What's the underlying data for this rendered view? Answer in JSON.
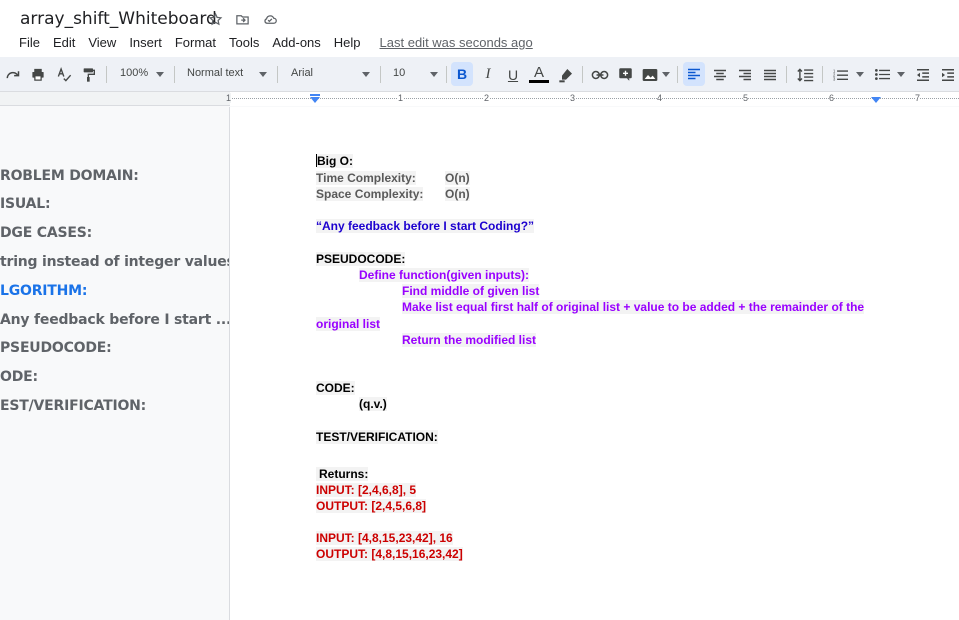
{
  "doc_title": "array_shift_Whiteboard",
  "menu": [
    "File",
    "Edit",
    "View",
    "Insert",
    "Format",
    "Tools",
    "Add-ons",
    "Help"
  ],
  "last_edit": "Last edit was seconds ago",
  "toolbar": {
    "zoom": "100%",
    "style": "Normal text",
    "font": "Arial",
    "size": "10",
    "bold": "B",
    "italic": "I",
    "underline": "U",
    "text_color": "A"
  },
  "ruler_numbers": [
    "1",
    "1",
    "2",
    "3",
    "4",
    "5",
    "6",
    "7"
  ],
  "outline": [
    "ROBLEM DOMAIN:",
    "ISUAL:",
    "DGE CASES:",
    "tring instead of integer values",
    "LGORITHM:",
    "Any feedback before I start ...",
    "PSEUDOCODE:",
    "ODE:",
    "EST/VERIFICATION:"
  ],
  "doc": {
    "big_o": "Big O:",
    "time_label": "Time Complexity:",
    "time_value": "O(n)",
    "space_label": "Space Complexity:",
    "space_value": "O(n)",
    "feedback": "“Any feedback before I start Coding?”",
    "pseudocode_heading": "PSEUDOCODE:",
    "pseudo_1": "Define function(given inputs):",
    "pseudo_2": "Find middle of given list",
    "pseudo_3a": "Make list equal first half of original list + value to be added + the remainder of the",
    "pseudo_3b": "original list",
    "pseudo_4": "Return the modified list",
    "code_heading": "CODE:",
    "code_ref": "(q.v.)",
    "test_heading": "TEST/VERIFICATION:",
    "returns": "Returns:",
    "input_1": "INPUT:  [2,4,6,8], 5",
    "output_1": "OUTPUT: [2,4,5,6,8]",
    "input_2": "INPUT:  [4,8,15,23,42], 16",
    "output_2": "OUTPUT: [4,8,15,16,23,42]"
  },
  "colors": {
    "accent": "#1a73e8",
    "purple": "#9900ff",
    "red": "#cc0000",
    "blue_quote": "#1c00cf"
  }
}
